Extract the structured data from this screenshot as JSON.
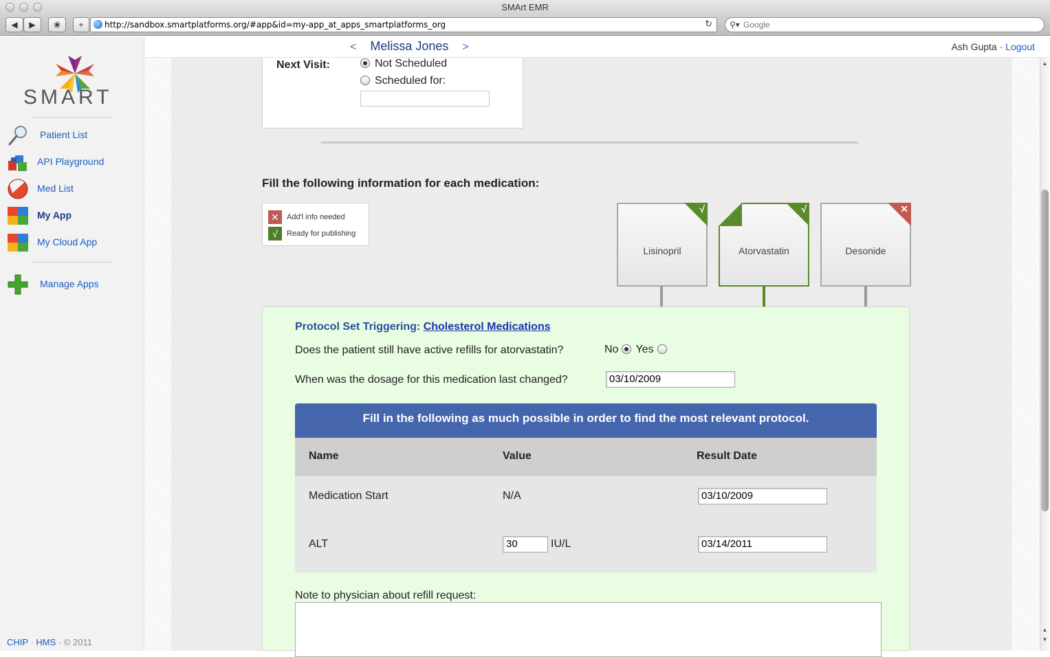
{
  "window": {
    "title": "SMArt EMR"
  },
  "browser": {
    "url": "http://sandbox.smartplatforms.org/#app&id=my-app_at_apps_smartplatforms_org",
    "search_placeholder": "Google"
  },
  "sidebar": {
    "logo_text": "SMART",
    "items": [
      {
        "label": "Patient List",
        "icon": "magnifier-icon"
      },
      {
        "label": "API Playground",
        "icon": "blocks-icon"
      },
      {
        "label": "Med List",
        "icon": "pill-icon"
      },
      {
        "label": "My App",
        "icon": "app-tiles-icon",
        "active": true
      },
      {
        "label": "My Cloud App",
        "icon": "app-tiles-icon"
      },
      {
        "label": "Manage Apps",
        "icon": "plus-icon"
      }
    ],
    "footer": {
      "chip": "CHIP",
      "hms": "HMS",
      "copyright": "© 2011"
    }
  },
  "header": {
    "prev": "<",
    "patient_name": "Melissa Jones",
    "next": ">",
    "user": "Ash Gupta",
    "separator": "·",
    "logout": "Logout"
  },
  "visit": {
    "label": "Next Visit:",
    "options": [
      {
        "label": "Not Scheduled",
        "selected": true
      },
      {
        "label": "Scheduled for:",
        "selected": false
      }
    ],
    "scheduled_value": ""
  },
  "medications": {
    "title": "Fill the following information for each medication:",
    "legend": [
      {
        "symbol": "✕",
        "label": "Add'l info needed",
        "color": "#c05a52"
      },
      {
        "symbol": "√",
        "label": "Ready for publishing",
        "color": "#4d7f28"
      }
    ],
    "cards": [
      {
        "name": "Lisinopril",
        "status_symbol": "√",
        "status": "ready"
      },
      {
        "name": "Atorvastatin",
        "status_symbol": "√",
        "status": "ready",
        "selected": true
      },
      {
        "name": "Desonide",
        "status_symbol": "✕",
        "status": "needs-info"
      }
    ]
  },
  "protocol": {
    "prefix": "Protocol Set Triggering:",
    "link": "Cholesterol Medications",
    "q_refills": "Does the patient still have active refills for atorvastatin?",
    "no_label": "No",
    "yes_label": "Yes",
    "refills_answer": "No",
    "q_dosage": "When was the dosage for this medication last changed?",
    "dosage_date": "03/10/2009",
    "banner": "Fill in the following as much possible in order to find the most relevant protocol.",
    "columns": [
      "Name",
      "Value",
      "Result Date"
    ],
    "rows": [
      {
        "name": "Medication Start",
        "value": "N/A",
        "unit": "",
        "date": "03/10/2009"
      },
      {
        "name": "ALT",
        "value": "30",
        "unit": "IU/L",
        "date": "03/14/2011"
      }
    ],
    "note_label": "Note to physician about refill request:",
    "note_value": ""
  },
  "colors": {
    "accent_blue": "#4565ad",
    "ready_green": "#5b8a2a",
    "needs_red": "#c05a52",
    "panel_green": "#e9fde2"
  }
}
